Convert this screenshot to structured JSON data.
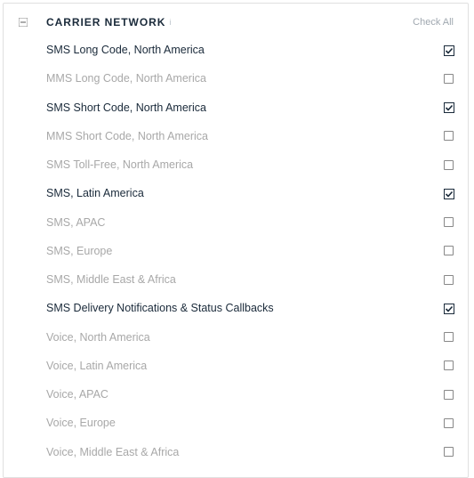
{
  "header": {
    "title": "CARRIER NETWORK",
    "info_glyph": "i",
    "check_all": "Check All"
  },
  "items": [
    {
      "label": "SMS Long Code, North America",
      "checked": true
    },
    {
      "label": "MMS Long Code, North America",
      "checked": false
    },
    {
      "label": "SMS Short Code, North America",
      "checked": true
    },
    {
      "label": "MMS Short Code, North America",
      "checked": false
    },
    {
      "label": "SMS Toll-Free, North America",
      "checked": false
    },
    {
      "label": "SMS, Latin America",
      "checked": true
    },
    {
      "label": "SMS, APAC",
      "checked": false
    },
    {
      "label": "SMS, Europe",
      "checked": false
    },
    {
      "label": "SMS, Middle East & Africa",
      "checked": false
    },
    {
      "label": "SMS Delivery Notifications & Status Callbacks",
      "checked": true
    },
    {
      "label": "Voice, North America",
      "checked": false
    },
    {
      "label": "Voice, Latin America",
      "checked": false
    },
    {
      "label": "Voice, APAC",
      "checked": false
    },
    {
      "label": "Voice, Europe",
      "checked": false
    },
    {
      "label": "Voice, Middle East & Africa",
      "checked": false
    }
  ],
  "colors": {
    "accent": "#1a2a3a",
    "muted": "#a8a8a8",
    "border": "#e0e0e0"
  }
}
